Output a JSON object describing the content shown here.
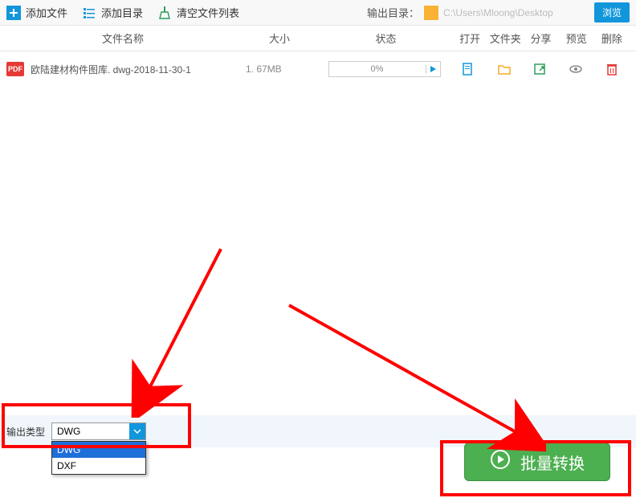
{
  "toolbar": {
    "add_file": "添加文件",
    "add_dir": "添加目录",
    "clear_list": "清空文件列表",
    "out_dir_label": "输出目录：",
    "out_path": "C:\\Users\\Mloong\\Desktop",
    "browse": "浏览"
  },
  "headers": {
    "name": "文件名称",
    "size": "大小",
    "status": "状态",
    "open": "打开",
    "folder": "文件夹",
    "share": "分享",
    "preview": "预览",
    "delete": "删除"
  },
  "file": {
    "badge": "PDF",
    "name": "欧陆建材构件图库. dwg-2018-11-30-1",
    "size": "1. 67MB",
    "progress": "0%"
  },
  "output_type": {
    "label": "输出类型",
    "selected": "DWG",
    "options": [
      "DWG",
      "DXF"
    ]
  },
  "convert_btn": "批量转换"
}
